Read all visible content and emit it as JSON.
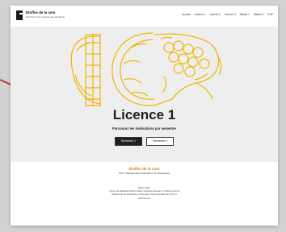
{
  "header": {
    "site_title": "Etoffes de la com",
    "tagline": "Découvrez les savoirs des étudiants",
    "nav": [
      "Accueil",
      "Licence 1",
      "Licence 2",
      "Licence 3",
      "Master 1",
      "Master 2",
      "EUP"
    ]
  },
  "hero": {
    "title": "Licence 1",
    "subtitle": "Parcourez les réalisations par semestre",
    "buttons": [
      "Semestre 1",
      "Semestre 2"
    ]
  },
  "footer": {
    "brand": "Etoffes de la com",
    "department": "TOC / Département Information Communication",
    "credits": [
      "Édition 2022",
      "Conçu par Madeleine Marty, Hakim Hortense Dessaint, et Pablo Lacomte",
      "Réalisé par les étudiants en Information-Communication de l'IUT, et",
      "de Photo tes"
    ]
  },
  "colors": {
    "accent": "#e07a1f",
    "illustration": "#f1b500",
    "dark": "#1f1f1f"
  }
}
